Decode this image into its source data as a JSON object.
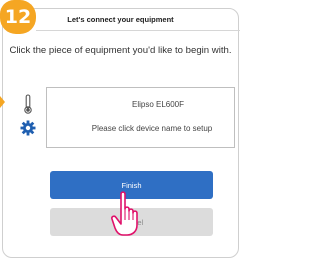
{
  "step": {
    "number": "12"
  },
  "header": {
    "title": "Let's connect your equipment"
  },
  "instruction": "Click the piece of equipment you'd like to begin with.",
  "device": {
    "name": "Elipso EL600F",
    "hint": "Please click device name to setup",
    "icons": [
      "thermometer-icon",
      "gear-icon"
    ]
  },
  "buttons": {
    "finish_label": "Finish",
    "cancel_label": "Cancel"
  },
  "colors": {
    "accent": "#f5a623",
    "primary_button": "#2f6fc4",
    "secondary_button": "#dcdcdc",
    "icon": "#1f5fb0"
  }
}
